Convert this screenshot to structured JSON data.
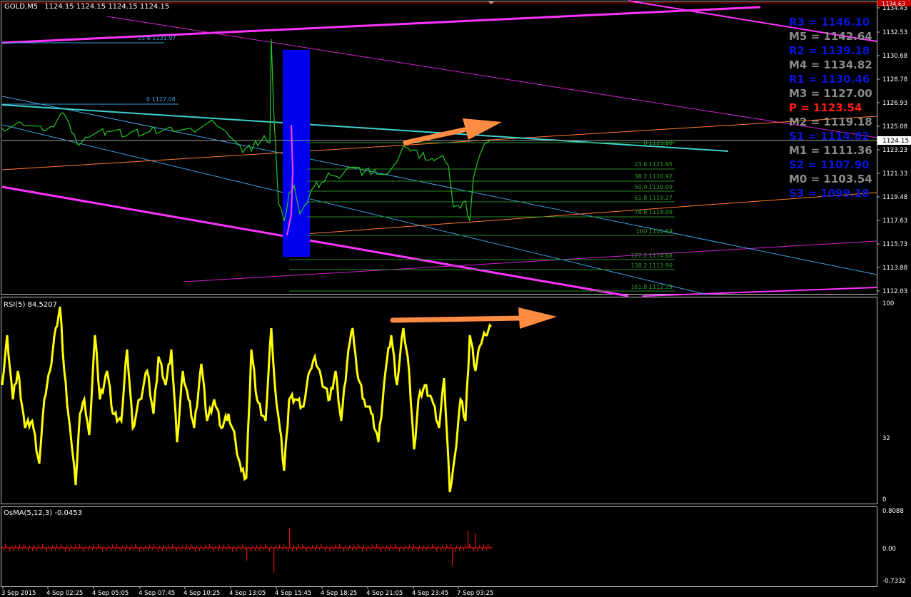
{
  "colors": {
    "background": "#000000",
    "grid_frame": "#c0c0c0",
    "price_line": "#22c822",
    "rsi_line": "#ffff00",
    "osma_bars": "#e01010",
    "arrow": "#ff8c42",
    "cyan_line": "#40d0d0",
    "blue_rect": "#0000ee",
    "channel_magenta": "#ff33ff",
    "fib_green": "#2a8a2a",
    "pivot_blue": "#0a14d8",
    "pivot_gray": "#8c8c8c",
    "pivot_red": "#ff1a1a",
    "current_price_box": "#ffffff",
    "top_price_box": "#c80000"
  },
  "main_chart": {
    "title": "GOLD,M5",
    "ohlc": "1124.15 1124.15 1124.15 1124.15",
    "current_price": "1124.15",
    "top_price": "1134.63",
    "price_axis": [
      "1134.43",
      "1132.53",
      "1130.68",
      "1128.78",
      "1126.93",
      "1125.08",
      "1123.23",
      "1121.33",
      "1119.48",
      "1117.63",
      "1115.73",
      "1113.88",
      "1112.03"
    ],
    "fib_left": [
      {
        "label": "23.6 1131.97"
      },
      {
        "label": "0 1127.08"
      }
    ],
    "fib_right": [
      {
        "label": "0 1123.60"
      },
      {
        "label": "23.6 1121.95"
      },
      {
        "label": "38.2 1120.92"
      },
      {
        "label": "50.0 1120.09"
      },
      {
        "label": "61.8 1119.27"
      },
      {
        "label": "78.6 1118.09"
      },
      {
        "label": "100 1116.59"
      },
      {
        "label": "127.2 1114.68"
      },
      {
        "label": "138.2 1113.90"
      },
      {
        "label": "161.8 1112.25"
      }
    ],
    "pivots": [
      {
        "label": "R3 = 1146.10",
        "kind": "resistance"
      },
      {
        "label": "M5 = 1142.64",
        "kind": "mid"
      },
      {
        "label": "R2 = 1139.18",
        "kind": "resistance"
      },
      {
        "label": "M4 = 1134.82",
        "kind": "mid"
      },
      {
        "label": "R1 = 1130.46",
        "kind": "resistance"
      },
      {
        "label": "M3 = 1127.00",
        "kind": "mid"
      },
      {
        "label": "P   = 1123.54",
        "kind": "pivot"
      },
      {
        "label": "M2 = 1119.18",
        "kind": "mid"
      },
      {
        "label": "S1 = 1114.82",
        "kind": "support"
      },
      {
        "label": "M1 = 1111.36",
        "kind": "mid"
      },
      {
        "label": "S2 = 1107.90",
        "kind": "support"
      },
      {
        "label": "M0 = 1103.54",
        "kind": "mid"
      },
      {
        "label": "S3 = 1099.18",
        "kind": "support"
      }
    ]
  },
  "rsi_panel": {
    "title": "RSI(5) 84.5207",
    "axis": [
      "100",
      "32",
      "0"
    ]
  },
  "osma_panel": {
    "title": "OsMA(5,12,3) -0.0453",
    "axis": [
      "0.8088",
      "0.00",
      "-0.7332"
    ]
  },
  "time_axis": [
    "3 Sep 2015",
    "4 Sep 02:25",
    "4 Sep 05:05",
    "4 Sep 07:45",
    "4 Sep 10:25",
    "4 Sep 13:05",
    "4 Sep 15:45",
    "4 Sep 18:25",
    "4 Sep 21:05",
    "4 Sep 23:45",
    "7 Sep 03:25"
  ]
}
